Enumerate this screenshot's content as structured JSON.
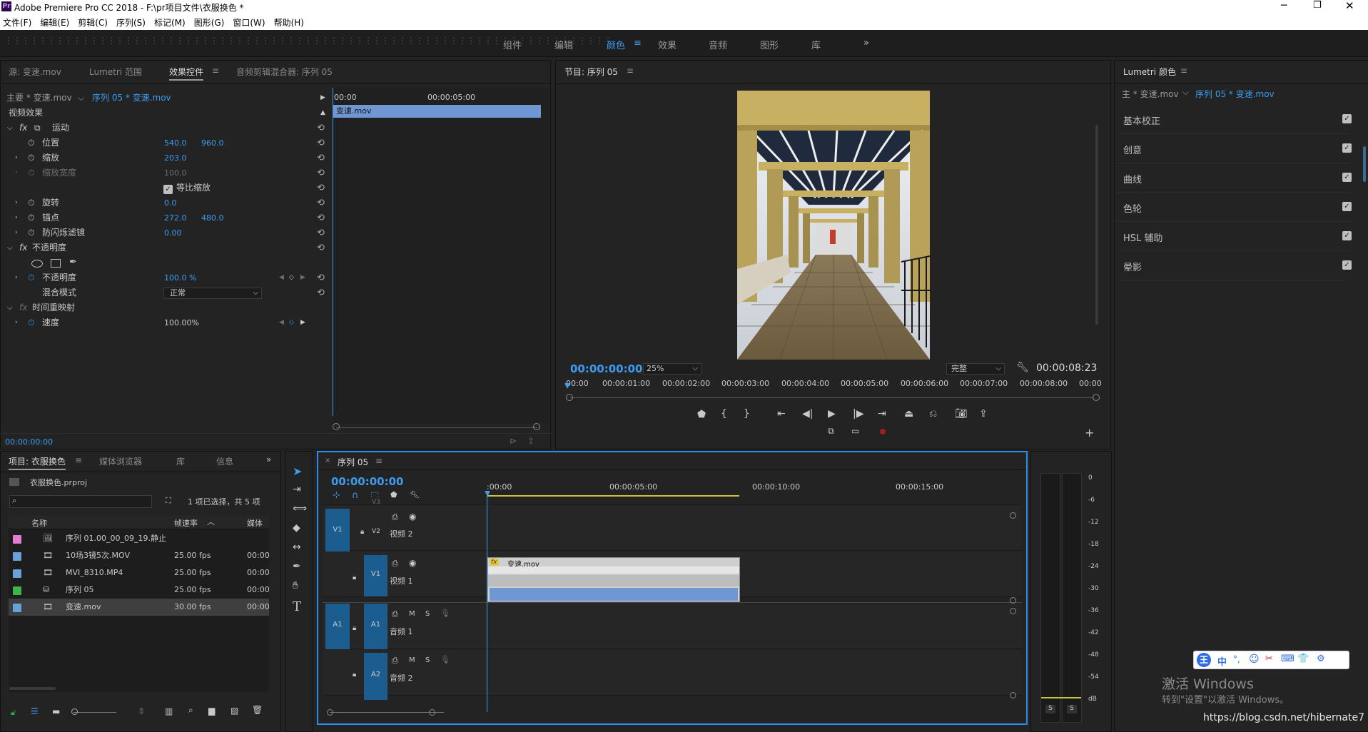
{
  "app": {
    "title": "Adobe Premiere Pro CC 2018 - F:\\pr项目文件\\衣服换色 *",
    "logo": "Pr"
  },
  "menu": [
    "文件(F)",
    "编辑(E)",
    "剪辑(C)",
    "序列(S)",
    "标记(M)",
    "图形(G)",
    "窗口(W)",
    "帮助(H)"
  ],
  "workspaces": [
    "组件",
    "编辑",
    "颜色",
    "效果",
    "音频",
    "图形",
    "库"
  ],
  "active_workspace": "颜色",
  "source_panel": {
    "tabs": [
      "源: 变速.mov",
      "Lumetri 范围",
      "效果控件",
      "音频剪辑混合器: 序列 05"
    ],
    "active_tab": "效果控件",
    "clip_master": "主要 * 变速.mov",
    "clip_seq": "序列 05 * 变速.mov",
    "ruler": [
      "00:00",
      "00:00:05:00"
    ],
    "clip_bar": "变速.mov",
    "section_video": "视频效果",
    "motion": "运动",
    "props": {
      "position": {
        "label": "位置",
        "v1": "540.0",
        "v2": "960.0"
      },
      "scale": {
        "label": "缩放",
        "v1": "203.0"
      },
      "scale_width": {
        "label": "缩放宽度",
        "v1": "100.0"
      },
      "uniform": {
        "label": "等比缩放"
      },
      "rotation": {
        "label": "旋转",
        "v1": "0.0"
      },
      "anchor": {
        "label": "锚点",
        "v1": "272.0",
        "v2": "480.0"
      },
      "flicker": {
        "label": "防闪烁滤镜",
        "v1": "0.00"
      }
    },
    "opacity_group": "不透明度",
    "opacity": {
      "label": "不透明度",
      "v1": "100.0 %"
    },
    "blend": {
      "label": "混合模式",
      "value": "正常"
    },
    "time_remap": "时间重映射",
    "speed": {
      "label": "速度",
      "v1": "100.00%"
    },
    "timecode": "00:00:00:00"
  },
  "program": {
    "title": "节目: 序列 05",
    "timecode": "00:00:00:00",
    "zoom": "25%",
    "quality": "完整",
    "duration": "00:00:08:23",
    "ruler": [
      "00:00",
      "00:00:01:00",
      "00:00:02:00",
      "00:00:03:00",
      "00:00:04:00",
      "00:00:05:00",
      "00:00:06:00",
      "00:00:07:00",
      "00:00:08:00",
      "00:00"
    ]
  },
  "lumetri": {
    "title": "Lumetri 颜色",
    "master": "主 * 变速.mov",
    "seq": "序列 05 * 变速.mov",
    "sections": [
      "基本校正",
      "创意",
      "曲线",
      "色轮",
      "HSL 辅助",
      "晕影"
    ]
  },
  "project": {
    "tabs": [
      "项目: 衣服换色",
      "媒体浏览器",
      "库",
      "信息"
    ],
    "file": "衣服换色.prproj",
    "selection": "1 项已选择，共 5 项",
    "columns": [
      "名称",
      "帧速率",
      "媒体"
    ],
    "items": [
      {
        "name": "序列 01.00_00_09_19.静止",
        "fps": "",
        "start": "",
        "color": "#e07fd0"
      },
      {
        "name": "10场3镜5次.MOV",
        "fps": "25.00 fps",
        "start": "00:00:",
        "color": "#6a9fd8"
      },
      {
        "name": "MVI_8310.MP4",
        "fps": "25.00 fps",
        "start": "00:00:",
        "color": "#6a9fd8"
      },
      {
        "name": "序列 05",
        "fps": "25.00 fps",
        "start": "00:00:",
        "color": "#3cb64a"
      },
      {
        "name": "变速.mov",
        "fps": "30.00 fps",
        "start": "00:00:",
        "color": "#6a9fd8"
      }
    ]
  },
  "timeline": {
    "tab": "序列 05",
    "timecode": "00:00:00:00",
    "ruler": [
      ":00:00",
      "00:00:05:00",
      "00:00:10:00",
      "00:00:15:00"
    ],
    "tracks": {
      "v3": "V3",
      "v2": "V2",
      "v1": "V1",
      "a1": "A1",
      "a2": "A2",
      "v2_name": "视频 2",
      "v1_name": "视频 1",
      "a1_name": "音频 1",
      "a2_name": "音频 2",
      "v1_patch": "V1",
      "a1_patch": "A1",
      "m": "M",
      "s": "S"
    },
    "clip": "变速.mov",
    "clip_fx": "fx"
  },
  "meter": {
    "scale": [
      "0",
      "-6",
      "-12",
      "-18",
      "-24",
      "-30",
      "-36",
      "-42",
      "-48",
      "-54",
      "dB"
    ],
    "solo": [
      "S",
      "S"
    ]
  },
  "overlay": {
    "ime": [
      "王",
      "中",
      "°,",
      "☺",
      "✂",
      "⌨",
      "👕",
      "⚙"
    ],
    "activate_title": "激活 Windows",
    "activate_sub": "转到\"设置\"以激活 Windows。",
    "watermark": "https://blog.csdn.net/hibernate7"
  },
  "colors": {
    "accent": "#3d9cf0",
    "clip": "#6f97d3",
    "track_patch": "#1c5d8f",
    "swatch_pink": "#e07fd0",
    "swatch_green": "#3cb64a"
  }
}
